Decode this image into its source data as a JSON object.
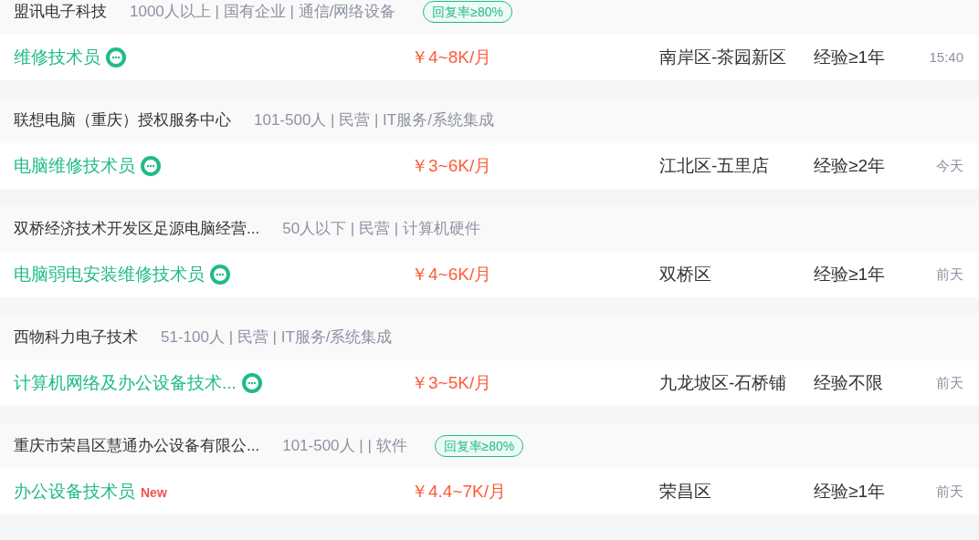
{
  "jobs": [
    {
      "company": "盟讯电子科技",
      "company_info": "1000人以上 | 国有企业 | 通信/网络设备",
      "badge": "回复率≥80%",
      "title": "维修技术员",
      "title_tag": {
        "kind": "chat"
      },
      "salary": "￥4~8K/月",
      "location": "南岸区-茶园新区",
      "experience": "经验≥1年",
      "time": "15:40"
    },
    {
      "company": "联想电脑（重庆）授权服务中心",
      "company_info": "101-500人 | 民营 | IT服务/系统集成",
      "title": "电脑维修技术员",
      "title_tag": {
        "kind": "chat"
      },
      "salary": "￥3~6K/月",
      "location": "江北区-五里店",
      "experience": "经验≥2年",
      "time": "今天"
    },
    {
      "company": "双桥经济技术开发区足源电脑经营...",
      "company_info": "50人以下 | 民营 | 计算机硬件",
      "title": "电脑弱电安装维修技术员",
      "title_tag": {
        "kind": "chat"
      },
      "salary": "￥4~6K/月",
      "location": "双桥区",
      "experience": "经验≥1年",
      "time": "前天"
    },
    {
      "company": "西物科力电子技术",
      "company_info": "51-100人 | 民营 | IT服务/系统集成",
      "title": "计算机网络及办公设备技术...",
      "title_tag": {
        "kind": "chat"
      },
      "salary": "￥3~5K/月",
      "location": "九龙坡区-石桥铺",
      "experience": "经验不限",
      "time": "前天"
    },
    {
      "company": "重庆市荣昌区慧通办公设备有限公...",
      "company_info": "101-500人 | | 软件",
      "badge": "回复率≥80%",
      "title": "办公设备技术员",
      "title_tag": {
        "kind": "new",
        "text": "New"
      },
      "salary": "￥4.4~7K/月",
      "location": "荣昌区",
      "experience": "经验≥1年",
      "time": "前天"
    }
  ]
}
